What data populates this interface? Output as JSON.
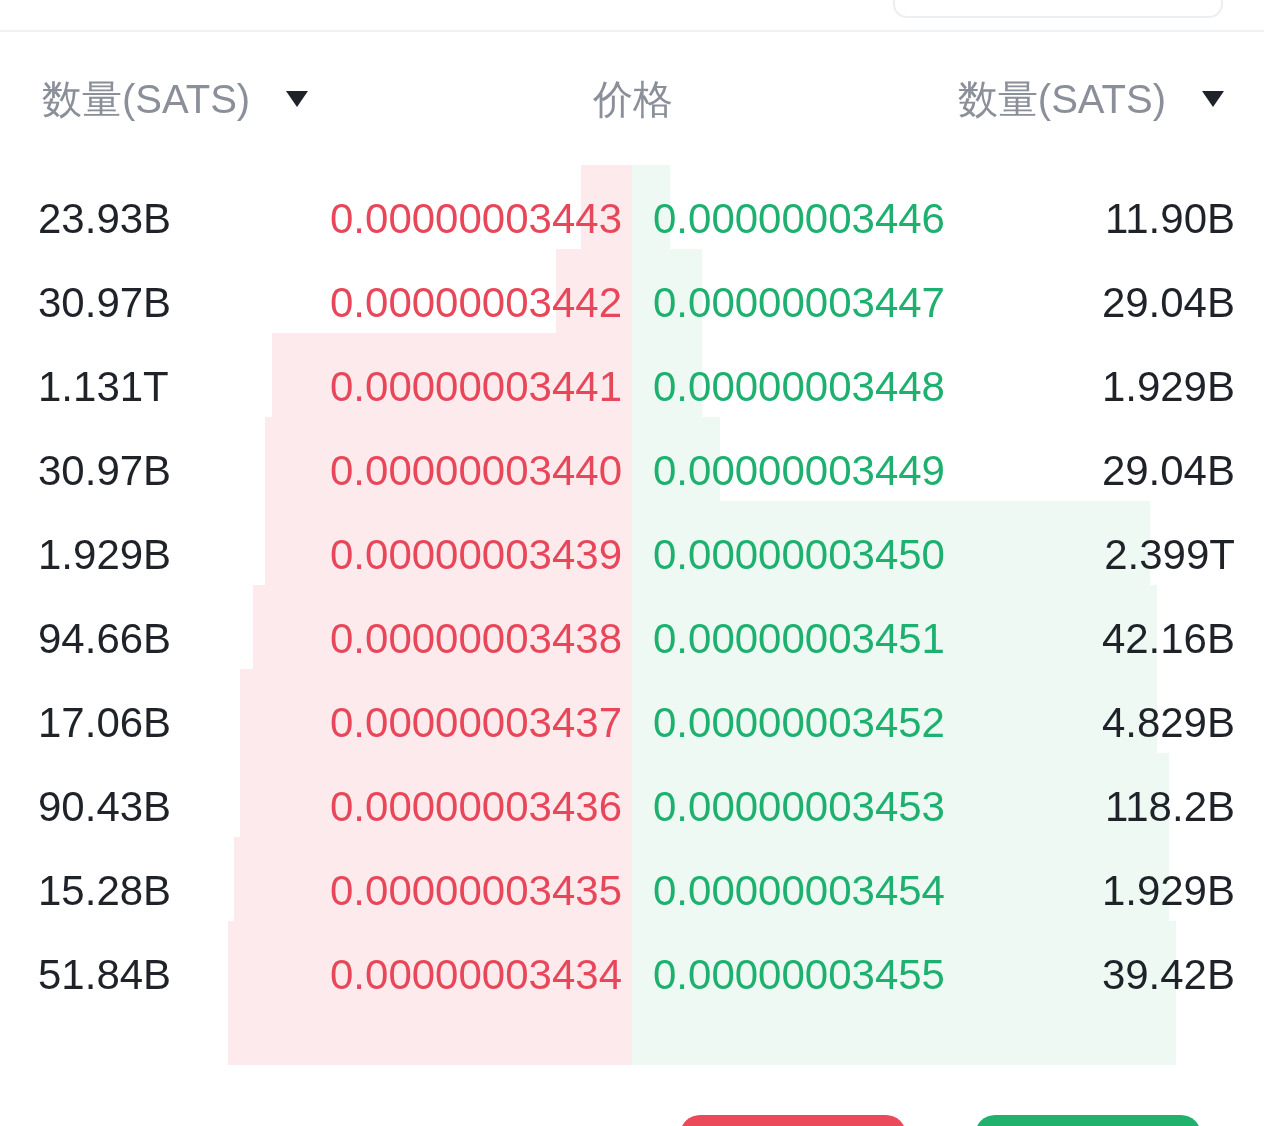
{
  "header": {
    "left_label": "数量(SATS)",
    "center_label": "价格",
    "right_label": "数量(SATS)"
  },
  "rows": [
    {
      "bid": {
        "qty": "23.93B",
        "price": "0.00000003443",
        "level": 0.08
      },
      "ask": {
        "price": "0.00000003446",
        "qty": "11.90B",
        "level": 0.06
      }
    },
    {
      "bid": {
        "qty": "30.97B",
        "price": "0.00000003442",
        "level": 0.12
      },
      "ask": {
        "price": "0.00000003447",
        "qty": "29.04B",
        "level": 0.11
      }
    },
    {
      "bid": {
        "qty": "1.131T",
        "price": "0.00000003441",
        "level": 0.57
      },
      "ask": {
        "price": "0.00000003448",
        "qty": "1.929B",
        "level": 0.11
      }
    },
    {
      "bid": {
        "qty": "30.97B",
        "price": "0.00000003440",
        "level": 0.58
      },
      "ask": {
        "price": "0.00000003449",
        "qty": "29.04B",
        "level": 0.14
      }
    },
    {
      "bid": {
        "qty": "1.929B",
        "price": "0.00000003439",
        "level": 0.58
      },
      "ask": {
        "price": "0.00000003450",
        "qty": "2.399T",
        "level": 0.82
      }
    },
    {
      "bid": {
        "qty": "94.66B",
        "price": "0.00000003438",
        "level": 0.6
      },
      "ask": {
        "price": "0.00000003451",
        "qty": "42.16B",
        "level": 0.83
      }
    },
    {
      "bid": {
        "qty": "17.06B",
        "price": "0.00000003437",
        "level": 0.62
      },
      "ask": {
        "price": "0.00000003452",
        "qty": "4.829B",
        "level": 0.83
      }
    },
    {
      "bid": {
        "qty": "90.43B",
        "price": "0.00000003436",
        "level": 0.62
      },
      "ask": {
        "price": "0.00000003453",
        "qty": "118.2B",
        "level": 0.85
      }
    },
    {
      "bid": {
        "qty": "15.28B",
        "price": "0.00000003435",
        "level": 0.63
      },
      "ask": {
        "price": "0.00000003454",
        "qty": "1.929B",
        "level": 0.85
      }
    },
    {
      "bid": {
        "qty": "51.84B",
        "price": "0.00000003434",
        "level": 0.64
      },
      "ask": {
        "price": "0.00000003455",
        "qty": "39.42B",
        "level": 0.86
      }
    },
    {
      "bid": {
        "level": 0.64
      },
      "ask": {
        "level": 0.86
      }
    }
  ]
}
